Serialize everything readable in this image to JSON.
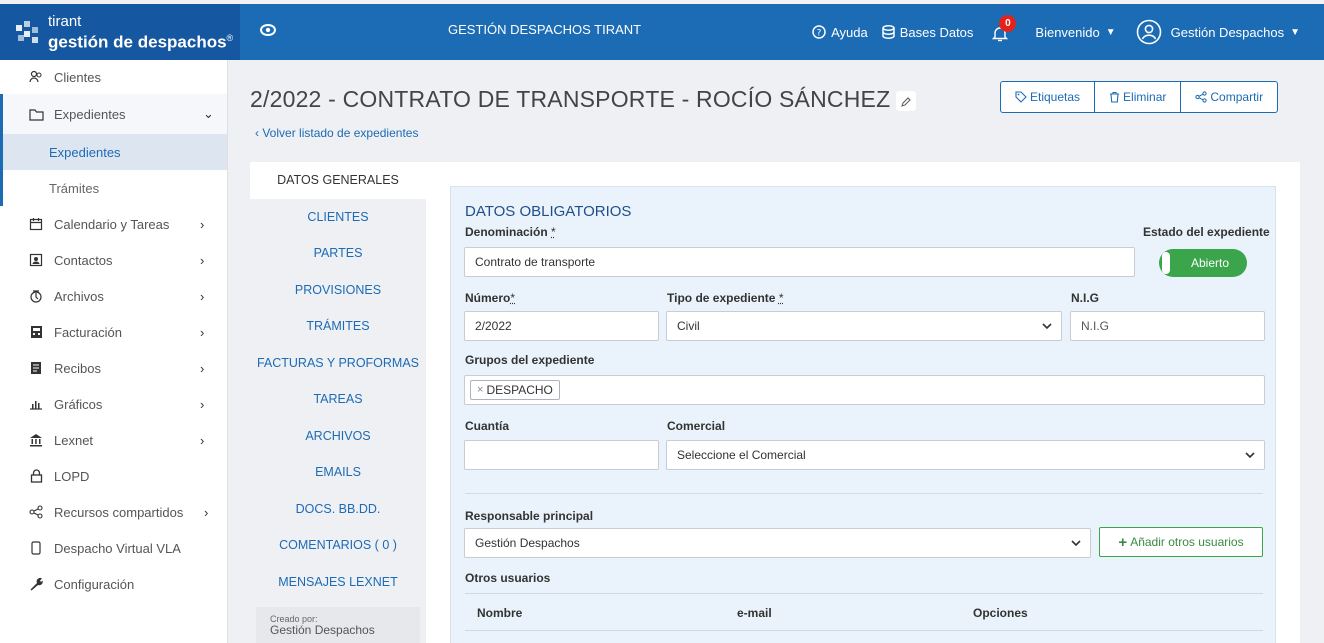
{
  "brand": {
    "line1": "tirant",
    "line2": "gestión de despachos",
    "reg": "®"
  },
  "topbar": {
    "app_title": "GESTIÓN DESPACHOS TIRANT",
    "help": "Ayuda",
    "databases": "Bases Datos",
    "notifications_count": "0",
    "welcome": "Bienvenido",
    "user": "Gestión Despachos"
  },
  "sidebar": {
    "items": [
      {
        "label": "Clientes",
        "icon": "users-icon"
      },
      {
        "label": "Expedientes",
        "icon": "folder-icon"
      },
      {
        "label": "Calendario y Tareas",
        "icon": "calendar-icon"
      },
      {
        "label": "Contactos",
        "icon": "contact-icon"
      },
      {
        "label": "Archivos",
        "icon": "archive-icon"
      },
      {
        "label": "Facturación",
        "icon": "calculator-icon"
      },
      {
        "label": "Recibos",
        "icon": "receipt-icon"
      },
      {
        "label": "Gráficos",
        "icon": "chart-icon"
      },
      {
        "label": "Lexnet",
        "icon": "institution-icon"
      },
      {
        "label": "LOPD",
        "icon": "lock-icon"
      },
      {
        "label": "Recursos compartidos",
        "icon": "share-icon"
      },
      {
        "label": "Despacho Virtual VLA",
        "icon": "mobile-icon"
      },
      {
        "label": "Configuración",
        "icon": "wrench-icon"
      }
    ],
    "sub_expedientes": "Expedientes",
    "sub_tramites": "Trámites"
  },
  "header": {
    "title": "2/2022 - CONTRATO DE TRANSPORTE - ROCÍO SÁNCHEZ",
    "back": "Volver listado de expedientes",
    "actions": {
      "tags": "Etiquetas",
      "delete": "Eliminar",
      "share": "Compartir"
    }
  },
  "tabs": [
    "DATOS GENERALES",
    "CLIENTES",
    "PARTES",
    "PROVISIONES",
    "TRÁMITES",
    "FACTURAS Y PROFORMAS",
    "TAREAS",
    "ARCHIVOS",
    "EMAILS",
    "DOCS. BB.DD.",
    "COMENTARIOS ( 0 )",
    "MENSAJES LEXNET"
  ],
  "created": {
    "label": "Creado por:",
    "name": "Gestión Despachos"
  },
  "form": {
    "section_title": "DATOS OBLIGATORIOS",
    "denominacion_label": "Denominación",
    "denominacion_value": "Contrato de transporte",
    "estado_label": "Estado del expediente",
    "estado_value": "Abierto",
    "numero_label": "Número",
    "numero_value": "2/2022",
    "tipo_label": "Tipo de expediente",
    "tipo_value": "Civil",
    "nig_label": "N.I.G",
    "nig_placeholder": "N.I.G",
    "grupos_label": "Grupos del expediente",
    "grupo_chip": "DESPACHO",
    "cuantia_label": "Cuantía",
    "comercial_label": "Comercial",
    "comercial_value": "Seleccione el Comercial",
    "responsable_label": "Responsable principal",
    "responsable_value": "Gestión Despachos",
    "add_users": "Añadir otros usuarios",
    "otros_label": "Otros usuarios",
    "table_headers": [
      "Nombre",
      "e-mail",
      "Opciones"
    ],
    "required_mark": "*"
  },
  "colors": {
    "primary": "#1c6bb5",
    "success": "#3aa54b",
    "badge": "#e2231a"
  }
}
